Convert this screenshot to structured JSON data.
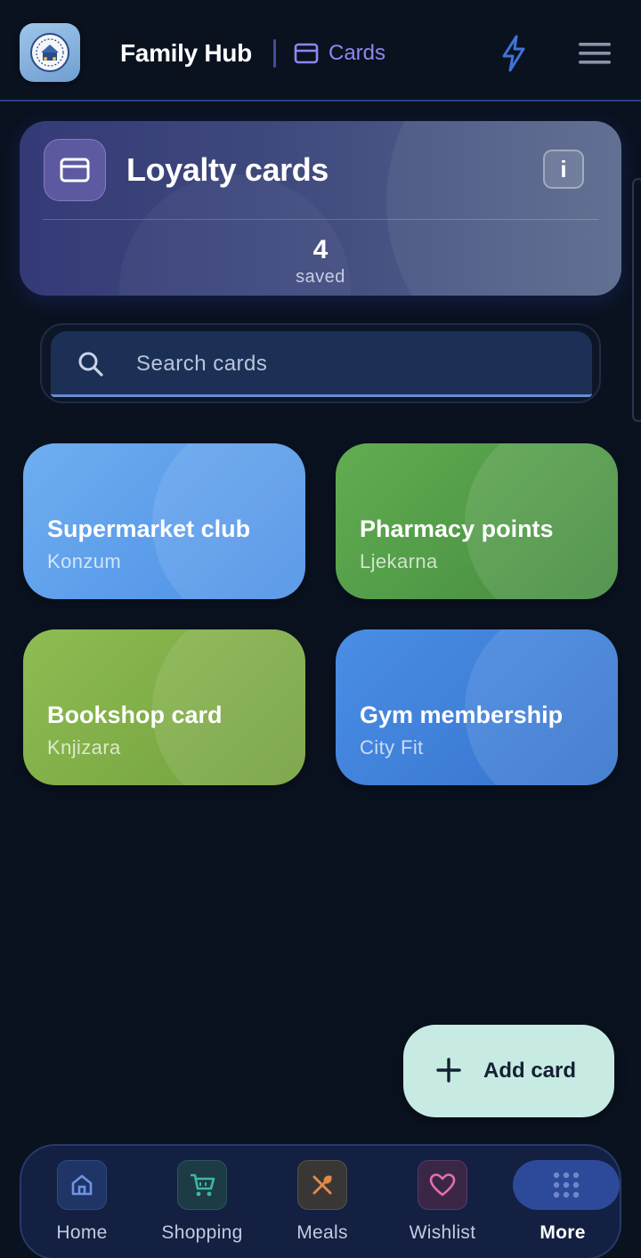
{
  "header": {
    "app_title": "Family Hub",
    "breadcrumb": "Cards",
    "logo_icon": "family-logo",
    "actions": [
      "bolt-icon",
      "menu-icon"
    ]
  },
  "summary": {
    "title": "Loyalty cards",
    "count": "4",
    "count_label": "saved",
    "info_label": "i"
  },
  "search": {
    "placeholder": "Search cards",
    "value": ""
  },
  "cards": [
    {
      "name": "Supermarket club",
      "store": "Konzum",
      "color": "#5b9ee8"
    },
    {
      "name": "Pharmacy points",
      "store": "Ljekarna",
      "color": "#56a04a"
    },
    {
      "name": "Bookshop card",
      "store": "Knjizara",
      "color": "#84b247"
    },
    {
      "name": "Gym membership",
      "store": "City Fit",
      "color": "#3f85df"
    }
  ],
  "fab": {
    "label": "Add card"
  },
  "nav": {
    "items": [
      {
        "label": "Home",
        "icon": "home-icon"
      },
      {
        "label": "Shopping",
        "icon": "cart-icon"
      },
      {
        "label": "Meals",
        "icon": "utensils-icon"
      },
      {
        "label": "Wishlist",
        "icon": "heart-icon"
      },
      {
        "label": "More",
        "icon": "grid-icon"
      }
    ],
    "active": "More"
  },
  "colors": {
    "background": "#0a1220",
    "accent": "#8e87ee",
    "nav_active": "#2d4a9a",
    "fab": "#c7ebe3"
  }
}
